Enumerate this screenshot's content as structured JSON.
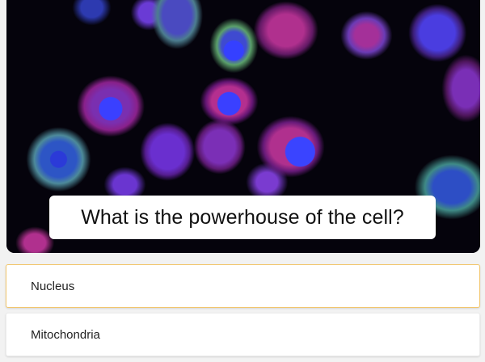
{
  "question": {
    "text": "What is the powerhouse of the cell?"
  },
  "answers": [
    {
      "label": "Nucleus",
      "highlighted": true
    },
    {
      "label": "Mitochondria",
      "highlighted": false
    }
  ],
  "colors": {
    "highlight_border": "#f2c66d",
    "answer_background": "#ffffff",
    "page_background": "#f2f2f2"
  }
}
